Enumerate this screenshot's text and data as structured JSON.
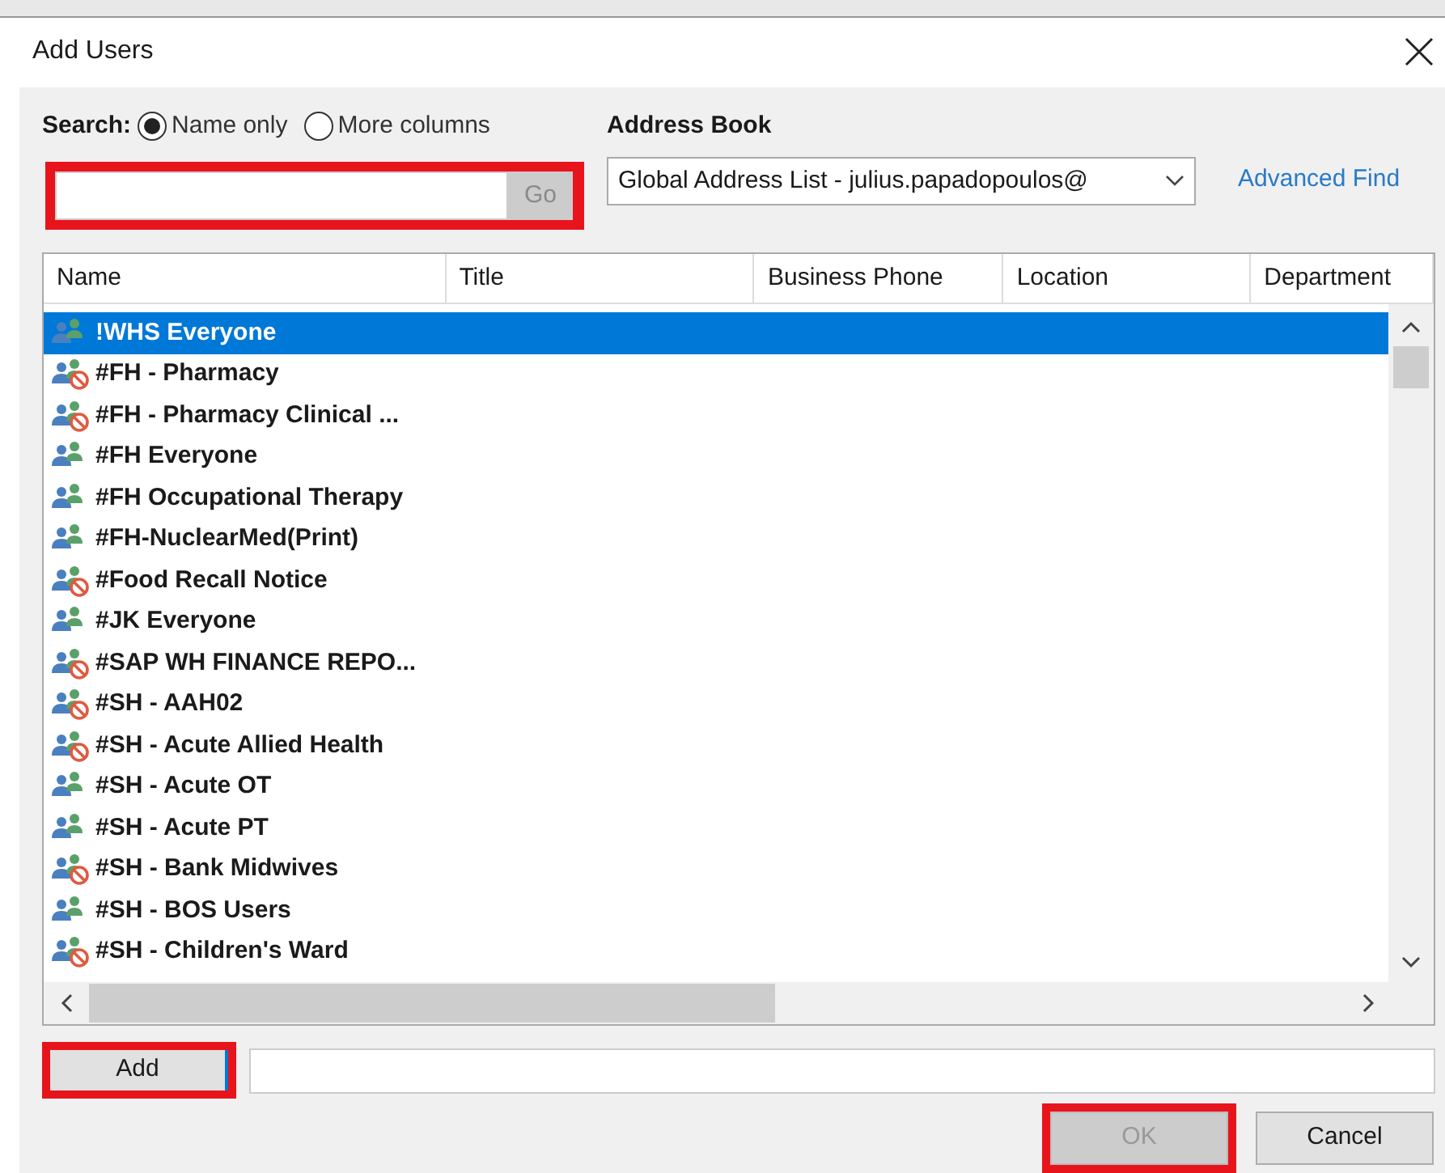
{
  "window": {
    "title": "Add Users"
  },
  "search": {
    "label": "Search:",
    "highlighted": true,
    "go_button": "Go",
    "options": [
      {
        "label": "Name only",
        "selected": true
      },
      {
        "label": "More columns",
        "selected": false
      }
    ]
  },
  "address_book": {
    "label": "Address Book",
    "value": "Global Address List - julius.papadopoulos@",
    "advanced_find": "Advanced Find"
  },
  "table": {
    "columns": [
      "Name",
      "Title",
      "Business Phone",
      "Location",
      "Department"
    ],
    "rows": [
      {
        "name": "!WHS Everyone",
        "kind": "group",
        "selected": true
      },
      {
        "name": "#FH - Pharmacy",
        "kind": "restricted",
        "selected": false
      },
      {
        "name": "#FH - Pharmacy Clinical ...",
        "kind": "restricted",
        "selected": false
      },
      {
        "name": "#FH Everyone",
        "kind": "group",
        "selected": false
      },
      {
        "name": "#FH Occupational Therapy",
        "kind": "group",
        "selected": false
      },
      {
        "name": "#FH-NuclearMed(Print)",
        "kind": "group",
        "selected": false
      },
      {
        "name": "#Food Recall Notice",
        "kind": "restricted",
        "selected": false
      },
      {
        "name": "#JK Everyone",
        "kind": "group",
        "selected": false
      },
      {
        "name": "#SAP WH FINANCE REPO...",
        "kind": "restricted",
        "selected": false
      },
      {
        "name": "#SH - AAH02",
        "kind": "restricted",
        "selected": false
      },
      {
        "name": "#SH - Acute Allied Health",
        "kind": "restricted",
        "selected": false
      },
      {
        "name": "#SH - Acute OT",
        "kind": "group",
        "selected": false
      },
      {
        "name": "#SH - Acute PT",
        "kind": "group",
        "selected": false
      },
      {
        "name": "#SH - Bank Midwives",
        "kind": "restricted",
        "selected": false
      },
      {
        "name": "#SH - BOS Users",
        "kind": "group",
        "selected": false
      },
      {
        "name": "#SH - Children's Ward",
        "kind": "restricted",
        "selected": false
      }
    ]
  },
  "add": {
    "button": "Add",
    "highlighted": true
  },
  "buttons": [
    {
      "label": "OK",
      "disabled": true,
      "highlighted": true
    },
    {
      "label": "Cancel",
      "disabled": false,
      "highlighted": false
    }
  ]
}
